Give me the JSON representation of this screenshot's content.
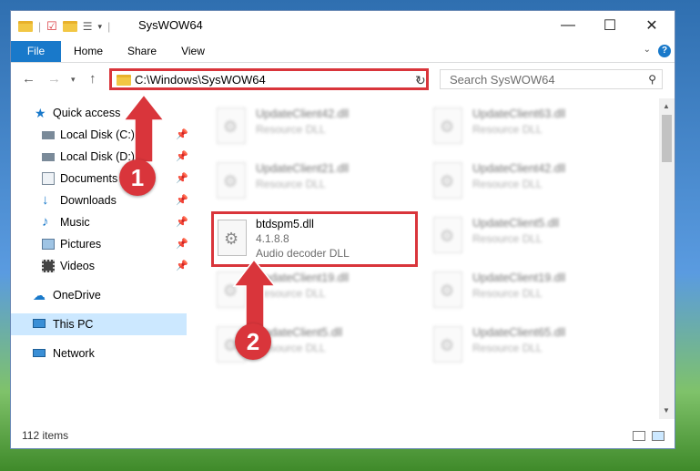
{
  "window": {
    "title": "SysWOW64"
  },
  "titlebar": {
    "minimize": "—",
    "maximize": "☐",
    "close": "✕"
  },
  "ribbon": {
    "tabs": [
      "File",
      "Home",
      "Share",
      "View"
    ],
    "help": "?"
  },
  "address": {
    "path": "C:\\Windows\\SysWOW64"
  },
  "search": {
    "placeholder": "Search SysWOW64"
  },
  "sidebar": {
    "items": [
      {
        "label": "Quick access"
      },
      {
        "label": "Local Disk (C:)"
      },
      {
        "label": "Local Disk (D:)"
      },
      {
        "label": "Documents"
      },
      {
        "label": "Downloads"
      },
      {
        "label": "Music"
      },
      {
        "label": "Pictures"
      },
      {
        "label": "Videos"
      },
      {
        "label": "OneDrive"
      },
      {
        "label": "This PC"
      },
      {
        "label": "Network"
      }
    ]
  },
  "files": [
    {
      "name": "UpdateClient42.dll",
      "line2": "Resource DLL",
      "line3": ""
    },
    {
      "name": "UpdateClient63.dll",
      "line2": "Resource DLL",
      "line3": ""
    },
    {
      "name": "UpdateClient21.dll",
      "line2": "Resource DLL",
      "line3": ""
    },
    {
      "name": "UpdateClient42.dll",
      "line2": "Resource DLL",
      "line3": ""
    },
    {
      "name": "btdspm5.dll",
      "line2": "4.1.8.8",
      "line3": "Audio decoder DLL"
    },
    {
      "name": "UpdateClient5.dll",
      "line2": "Resource DLL",
      "line3": ""
    },
    {
      "name": "UpdateClient19.dll",
      "line2": "Resource DLL",
      "line3": ""
    },
    {
      "name": "UpdateClient19.dll",
      "line2": "Resource DLL",
      "line3": ""
    },
    {
      "name": "UpdateClient5.dll",
      "line2": "Resource DLL",
      "line3": ""
    },
    {
      "name": "UpdateClient65.dll",
      "line2": "Resource DLL",
      "line3": ""
    }
  ],
  "status": {
    "item_count": "112 items"
  },
  "annotations": {
    "step1": "1",
    "step2": "2"
  },
  "colors": {
    "accent": "#1979ca",
    "highlight": "#d9353b"
  }
}
